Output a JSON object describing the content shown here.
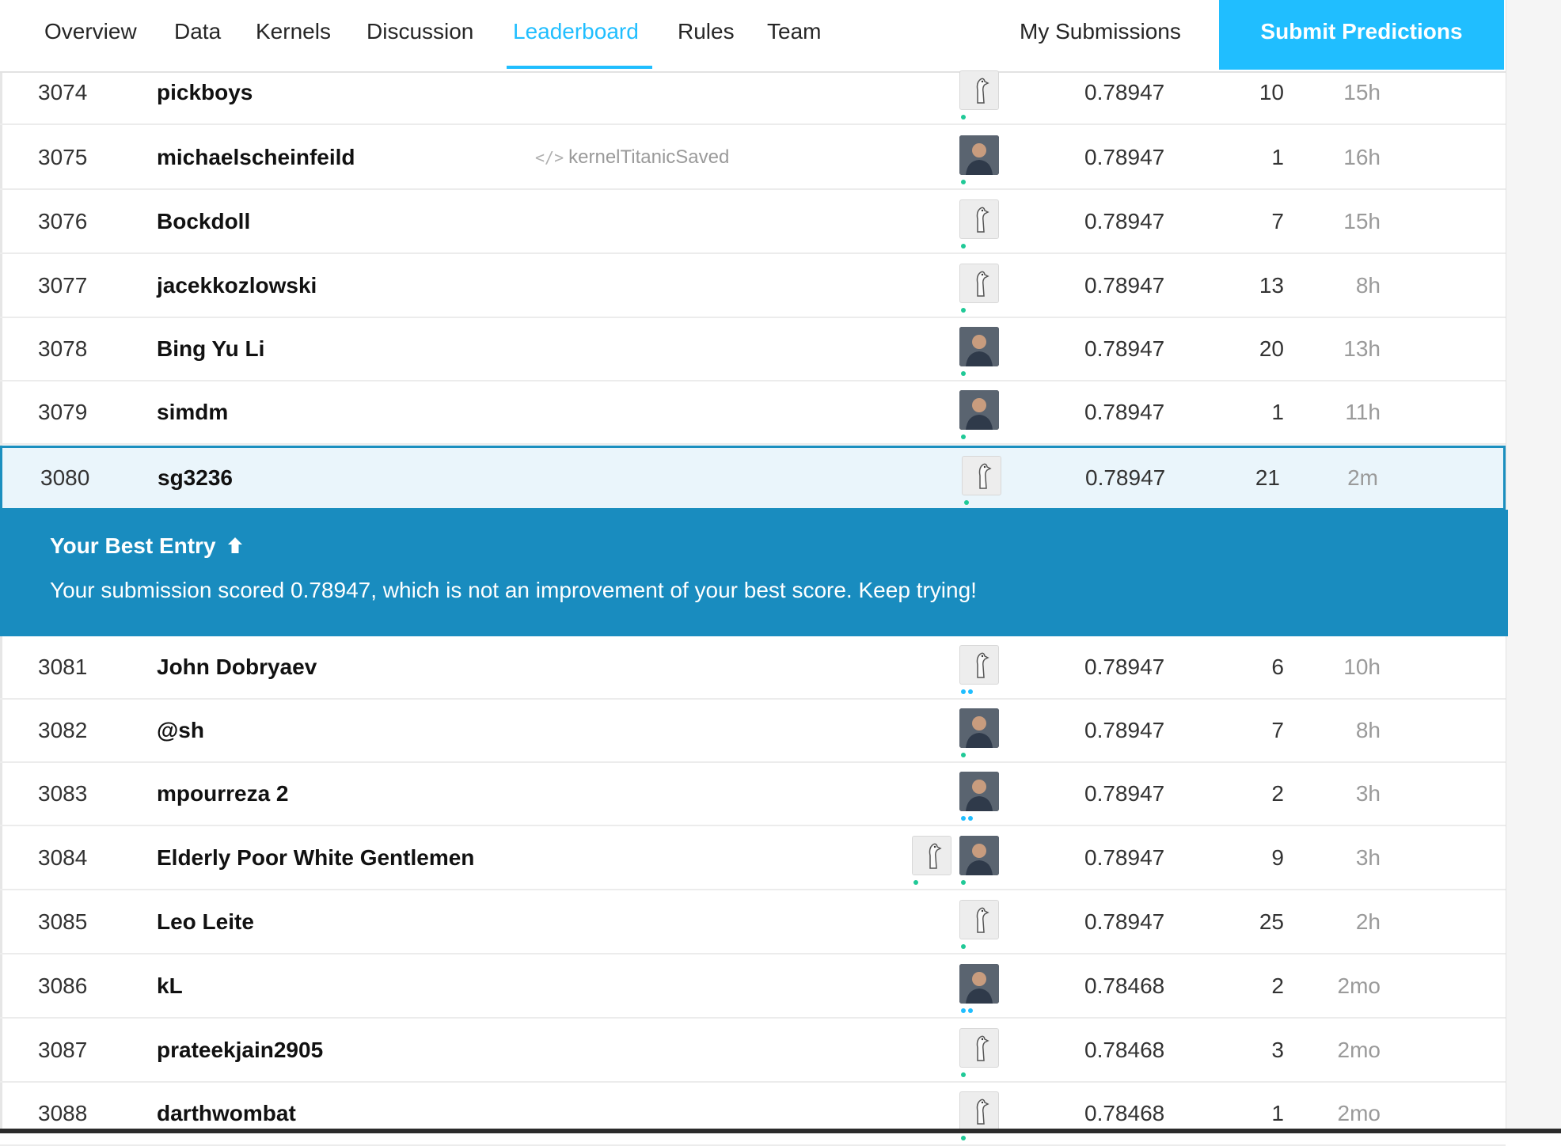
{
  "nav": {
    "tabs": [
      "Overview",
      "Data",
      "Kernels",
      "Discussion",
      "Leaderboard",
      "Rules",
      "Team"
    ],
    "active_tab": "Leaderboard",
    "my_submissions": "My Submissions",
    "submit_label": "Submit Predictions"
  },
  "colors": {
    "accent": "#20beff",
    "banner": "#198cbf",
    "highlight_row": "#eaf5fb"
  },
  "rows_top": [
    {
      "rank": "3074",
      "name": "pickboys",
      "kernel": "",
      "score": "0.78947",
      "entries": "10",
      "last": "15h",
      "avatars": [
        "goose"
      ],
      "tier": "green"
    },
    {
      "rank": "3075",
      "name": "michaelscheinfeild",
      "kernel": "kernelTitanicSaved",
      "score": "0.78947",
      "entries": "1",
      "last": "16h",
      "avatars": [
        "photo"
      ],
      "tier": "green"
    },
    {
      "rank": "3076",
      "name": "Bockdoll",
      "kernel": "",
      "score": "0.78947",
      "entries": "7",
      "last": "15h",
      "avatars": [
        "goose"
      ],
      "tier": "green"
    },
    {
      "rank": "3077",
      "name": "jacekkozlowski",
      "kernel": "",
      "score": "0.78947",
      "entries": "13",
      "last": "8h",
      "avatars": [
        "goose"
      ],
      "tier": "green"
    },
    {
      "rank": "3078",
      "name": "Bing Yu Li",
      "kernel": "",
      "score": "0.78947",
      "entries": "20",
      "last": "13h",
      "avatars": [
        "photo"
      ],
      "tier": "green"
    },
    {
      "rank": "3079",
      "name": "simdm",
      "kernel": "",
      "score": "0.78947",
      "entries": "1",
      "last": "11h",
      "avatars": [
        "photo"
      ],
      "tier": "green"
    }
  ],
  "my_row": {
    "rank": "3080",
    "name": "sg3236",
    "score": "0.78947",
    "entries": "21",
    "last": "2m",
    "avatars": [
      "goose"
    ],
    "tier": "green"
  },
  "banner": {
    "title": "Your Best Entry",
    "arrow_icon": "arrow-up-icon",
    "message": "Your submission scored 0.78947, which is not an improvement of your best score. Keep trying!"
  },
  "rows_bottom": [
    {
      "rank": "3081",
      "name": "John Dobryaev",
      "score": "0.78947",
      "entries": "6",
      "last": "10h",
      "avatars": [
        "goose"
      ],
      "tier": "blue"
    },
    {
      "rank": "3082",
      "name": "@sh",
      "score": "0.78947",
      "entries": "7",
      "last": "8h",
      "avatars": [
        "photo"
      ],
      "tier": "green"
    },
    {
      "rank": "3083",
      "name": "mpourreza 2",
      "score": "0.78947",
      "entries": "2",
      "last": "3h",
      "avatars": [
        "photo"
      ],
      "tier": "blue"
    },
    {
      "rank": "3084",
      "name": "Elderly Poor White Gentlemen",
      "score": "0.78947",
      "entries": "9",
      "last": "3h",
      "avatars": [
        "goose",
        "photo"
      ],
      "tier": "green"
    },
    {
      "rank": "3085",
      "name": "Leo Leite",
      "score": "0.78947",
      "entries": "25",
      "last": "2h",
      "avatars": [
        "goose"
      ],
      "tier": "green"
    },
    {
      "rank": "3086",
      "name": "kL",
      "score": "0.78468",
      "entries": "2",
      "last": "2mo",
      "avatars": [
        "photo"
      ],
      "tier": "blue"
    },
    {
      "rank": "3087",
      "name": "prateekjain2905",
      "score": "0.78468",
      "entries": "3",
      "last": "2mo",
      "avatars": [
        "goose"
      ],
      "tier": "green"
    },
    {
      "rank": "3088",
      "name": "darthwombat",
      "score": "0.78468",
      "entries": "1",
      "last": "2mo",
      "avatars": [
        "goose"
      ],
      "tier": "green"
    }
  ]
}
